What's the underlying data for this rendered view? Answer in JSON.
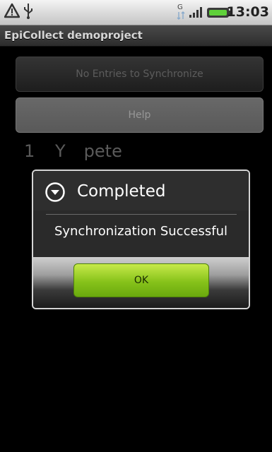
{
  "status_bar": {
    "time": "13:03",
    "icons": [
      "warning-icon",
      "usb-icon",
      "data-icon",
      "signal-icon",
      "battery-icon"
    ]
  },
  "app": {
    "title": "EpiCollect demoproject"
  },
  "buttons": {
    "sync_label": "No Entries to Synchronize",
    "help_label": "Help"
  },
  "entries": [
    {
      "number": "1",
      "flag": "Y",
      "name": "pete"
    }
  ],
  "dialog": {
    "title": "Completed",
    "message": "Synchronization Successful",
    "ok_label": "OK"
  },
  "colors": {
    "accent_green": "#86c21a",
    "background": "#000000"
  }
}
